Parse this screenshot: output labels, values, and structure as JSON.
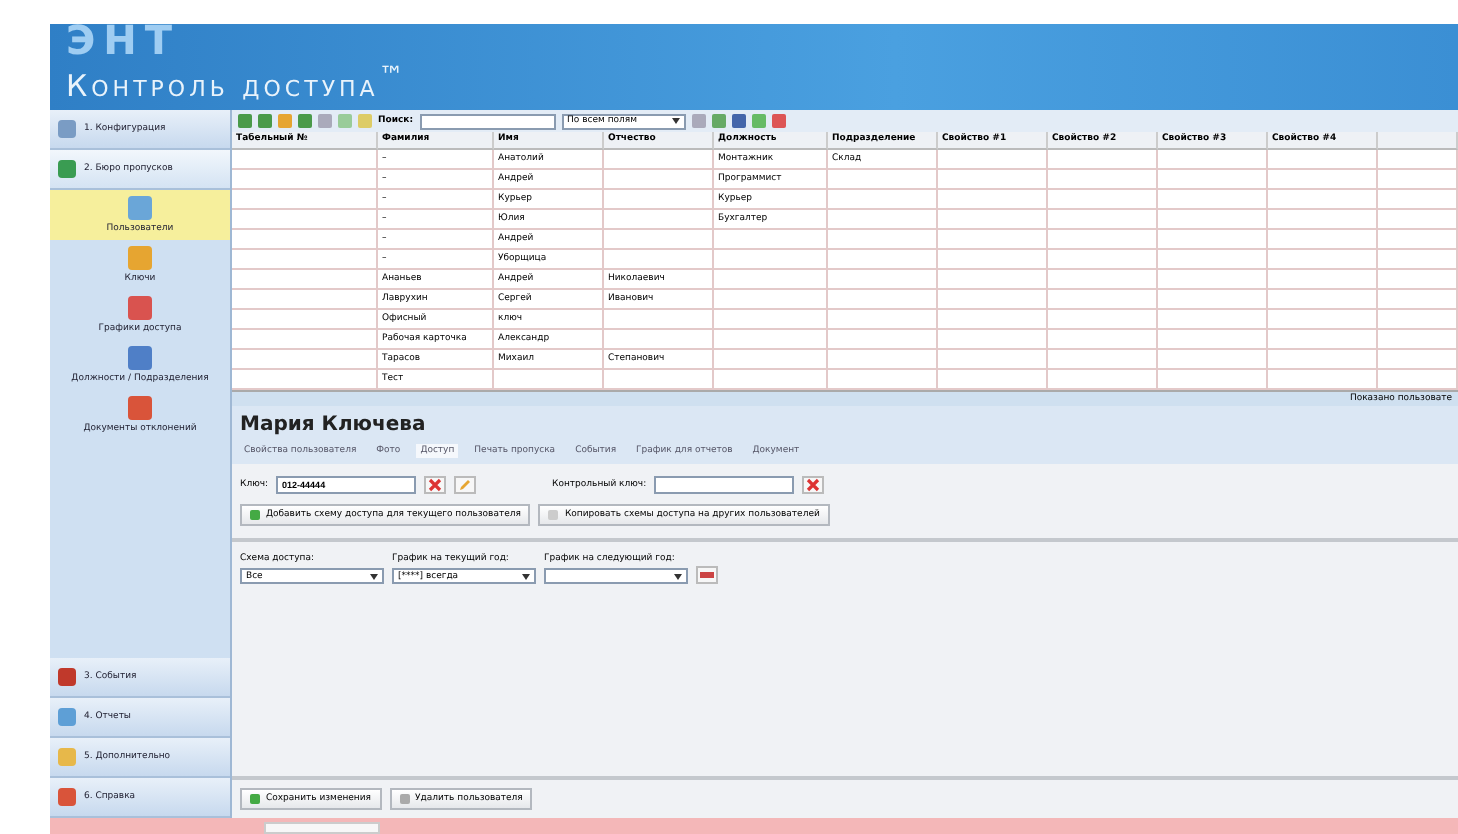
{
  "banner": {
    "watermark": "ЭНТ",
    "title": "Контроль доступа",
    "trademark": "$^{™}$"
  },
  "sidebar": {
    "sections_top": [
      {
        "label": "1. Конфигурация",
        "selected": false
      },
      {
        "label": "2. Бюро пропусков",
        "selected": true
      }
    ],
    "items": [
      {
        "label": "Пользователи",
        "selected": true
      },
      {
        "label": "Ключи",
        "selected": false
      },
      {
        "label": "Графики доступа",
        "selected": false
      },
      {
        "label": "Должности / Подразделения",
        "selected": false
      },
      {
        "label": "Документы отклонений",
        "selected": false
      }
    ],
    "sections_bottom": [
      {
        "label": "3. События"
      },
      {
        "label": "4. Отчеты"
      },
      {
        "label": "5. Дополнительно"
      },
      {
        "label": "6. Справка"
      }
    ]
  },
  "toolbar": {
    "search_label": "Поиск:",
    "scope": "По всем полям"
  },
  "table": {
    "columns": [
      "Табельный №",
      "Фамилия",
      "Имя",
      "Отчество",
      "Должность",
      "Подразделение",
      "Свойство #1",
      "Свойство #2",
      "Свойство #3",
      "Свойство #4"
    ],
    "rows": [
      [
        "",
        "–",
        "Анатолий",
        "",
        "Монтажник",
        "Склад"
      ],
      [
        "",
        "–",
        "Андрей",
        "",
        "Программист",
        ""
      ],
      [
        "",
        "–",
        "Курьер",
        "",
        "Курьер",
        ""
      ],
      [
        "",
        "–",
        "Юлия",
        "",
        "Бухгалтер",
        ""
      ],
      [
        "",
        "–",
        "Андрей",
        "",
        "",
        ""
      ],
      [
        "",
        "–",
        "Уборщица",
        "",
        "",
        ""
      ],
      [
        "",
        "Ананьев",
        "Андрей",
        "Николаевич",
        "",
        ""
      ],
      [
        "",
        "Лаврухин",
        "Сергей",
        "Иванович",
        "",
        ""
      ],
      [
        "",
        "Офисный",
        "ключ",
        "",
        "",
        ""
      ],
      [
        "",
        "Рабочая карточка",
        "Александр",
        "",
        "",
        ""
      ],
      [
        "",
        "Тарасов",
        "Михаил",
        "Степанович",
        "",
        ""
      ],
      [
        "",
        "Тест",
        "",
        "",
        "",
        ""
      ]
    ]
  },
  "status": "Показано пользовате",
  "detail": {
    "name": "Мария Ключева",
    "tabs": [
      {
        "label": "Свойства пользователя",
        "selected": false
      },
      {
        "label": "Фото",
        "selected": false
      },
      {
        "label": "Доступ",
        "selected": true
      },
      {
        "label": "Печать пропуска",
        "selected": false
      },
      {
        "label": "События",
        "selected": false
      },
      {
        "label": "График для отчетов",
        "selected": false
      },
      {
        "label": "Документ",
        "selected": false
      }
    ],
    "key_label": "Ключ:",
    "key_value": "012-44444",
    "control_key_label": "Контрольный ключ:",
    "add_button": "Добавить схему доступа для текущего пользователя",
    "copy_button": "Копировать схемы доступа на других пользователей",
    "fields": [
      {
        "label": "Схема доступа:",
        "value": "Все"
      },
      {
        "label": "График на текущий год:",
        "value": "[****] всегда"
      },
      {
        "label": "График на следующий год:"
      }
    ],
    "save_button": "Сохранить изменения",
    "delete_button": "Удалить пользователя"
  }
}
